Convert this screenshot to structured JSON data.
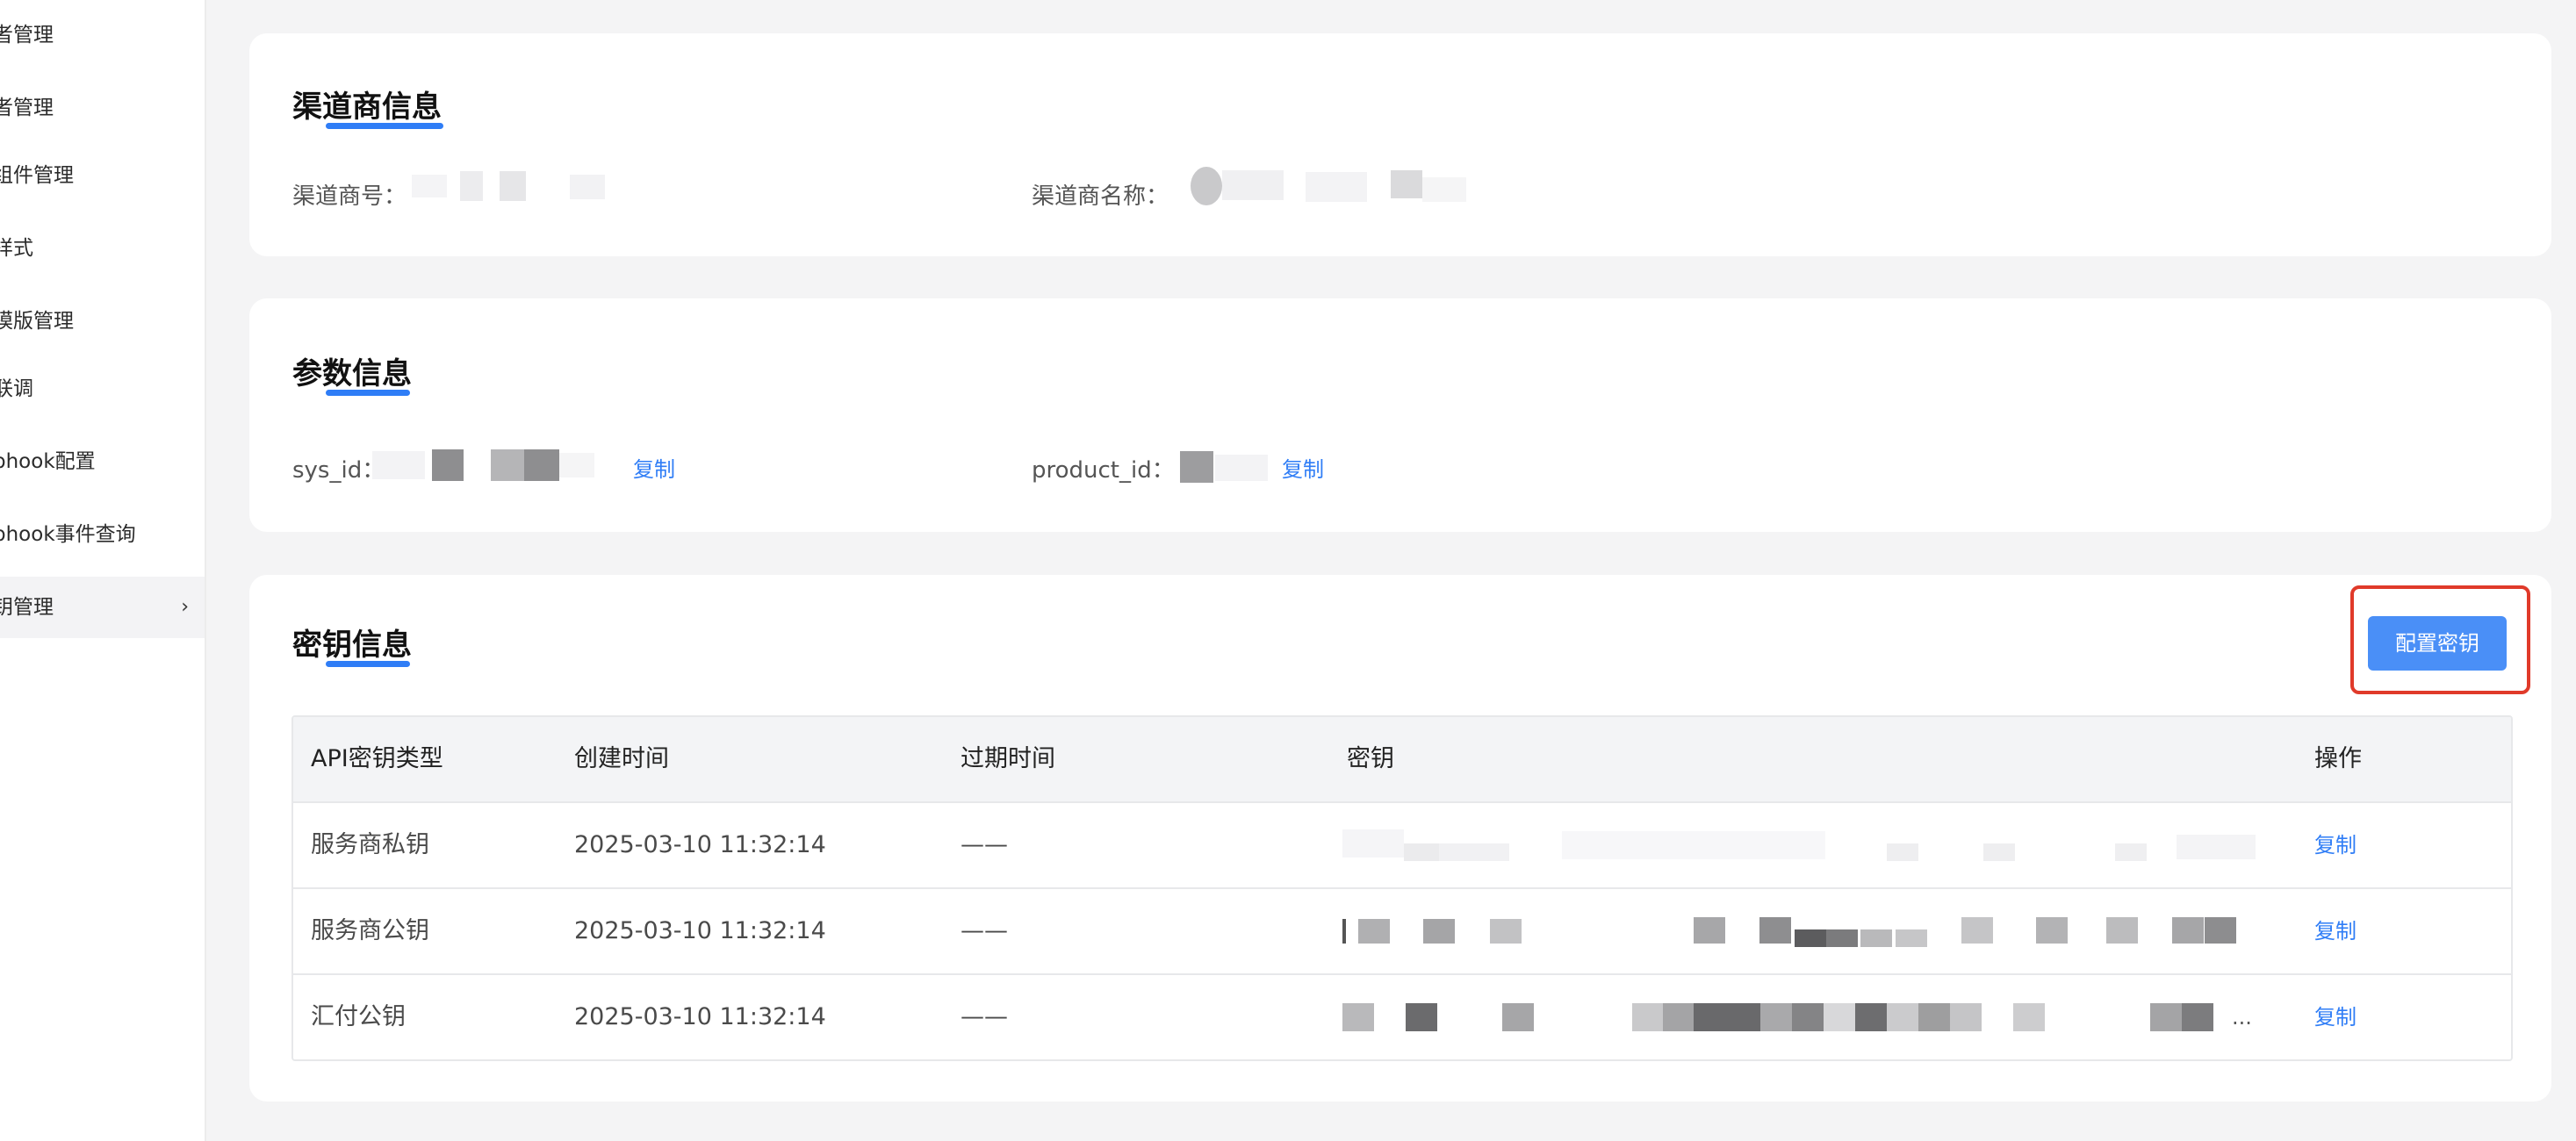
{
  "sidebar": {
    "items": [
      {
        "label": "者管理"
      },
      {
        "label": "者管理"
      },
      {
        "label": "组件管理"
      },
      {
        "label": "样式"
      },
      {
        "label": "模版管理"
      },
      {
        "label": "联调"
      },
      {
        "label": "phook配置"
      },
      {
        "label": "phook事件查询"
      },
      {
        "label": "钥管理",
        "chevron": "chevron-right-icon"
      }
    ]
  },
  "channel_info": {
    "title": "渠道商信息",
    "id_label": "渠道商号：",
    "name_label": "渠道商名称："
  },
  "param_info": {
    "title": "参数信息",
    "sys_id_label": "sys_id：",
    "product_id_label": "product_id：",
    "copy_label": "复制"
  },
  "key_info": {
    "title": "密钥信息",
    "config_button": "配置密钥",
    "table": {
      "headers": [
        "API密钥类型",
        "创建时间",
        "过期时间",
        "密钥",
        "操作"
      ],
      "rows": [
        {
          "type": "服务商私钥",
          "created": "2025-03-10 11:32:14",
          "expires": "——",
          "action": "复制"
        },
        {
          "type": "服务商公钥",
          "created": "2025-03-10 11:32:14",
          "expires": "——",
          "action": "复制"
        },
        {
          "type": "汇付公钥",
          "created": "2025-03-10 11:32:14",
          "expires": "——",
          "action": "复制",
          "key_suffix": "..."
        }
      ]
    }
  },
  "colors": {
    "accent": "#2f7df6",
    "highlight": "#e03a2a",
    "button": "#4a8ff7"
  }
}
